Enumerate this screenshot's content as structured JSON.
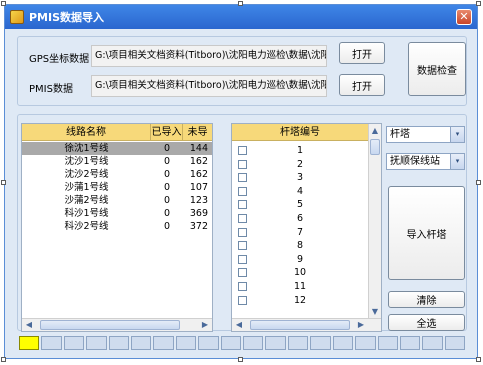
{
  "window": {
    "title": "PMIS数据导入",
    "close_label": "✕"
  },
  "inputs": {
    "gps_label": "GPS坐标数据",
    "gps_path": "G:\\项目相关文档资料(Titboro)\\沈阳电力巡检\\数据\\沈阳站",
    "gps_open": "打开",
    "pmis_label": "PMIS数据",
    "pmis_path": "G:\\项目相关文档资料(Titboro)\\沈阳电力巡检\\数据\\沈阳站",
    "pmis_open": "打开",
    "check_button": "数据检查"
  },
  "lines_table": {
    "columns": [
      "线路名称",
      "已导入",
      "未导入"
    ],
    "rows": [
      {
        "name": "徐沈1号线",
        "imported": "0",
        "pending": "144",
        "selected": true
      },
      {
        "name": "沈沙1号线",
        "imported": "0",
        "pending": "162"
      },
      {
        "name": "沈沙2号线",
        "imported": "0",
        "pending": "162"
      },
      {
        "name": "沙蒲1号线",
        "imported": "0",
        "pending": "107"
      },
      {
        "name": "沙蒲2号线",
        "imported": "0",
        "pending": "123"
      },
      {
        "name": "科沙1号线",
        "imported": "0",
        "pending": "369"
      },
      {
        "name": "科沙2号线",
        "imported": "0",
        "pending": "372"
      }
    ]
  },
  "tower_table": {
    "column": "杆塔编号",
    "rows": [
      "1",
      "2",
      "3",
      "4",
      "5",
      "6",
      "7",
      "8",
      "9",
      "10",
      "11",
      "12"
    ]
  },
  "side": {
    "type_select": "杆塔",
    "station_select": "抚顺保线站",
    "import_button": "导入杆塔",
    "clear_button": "清除",
    "select_all_button": "全选"
  },
  "icons": {
    "dropdown": "▾",
    "up": "▲",
    "down": "▼",
    "left": "◀",
    "right": "▶"
  },
  "progress": {
    "segments": 20,
    "filled": 1
  }
}
